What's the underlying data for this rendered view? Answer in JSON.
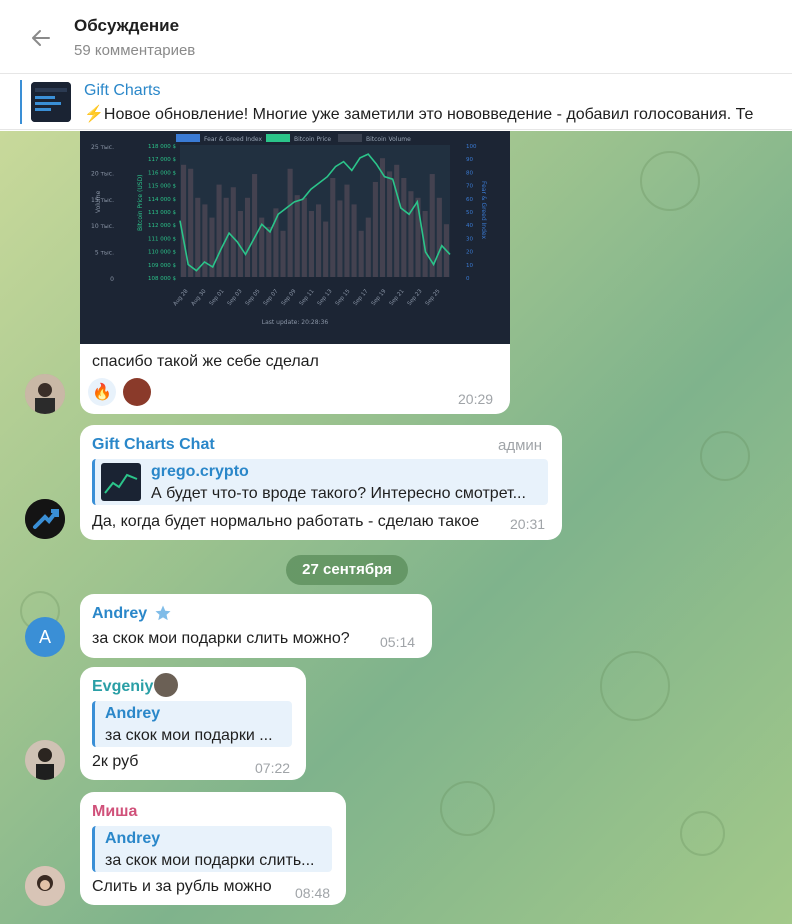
{
  "header": {
    "title": "Обсуждение",
    "subtitle": "59 комментариев"
  },
  "pinned": {
    "channel": "Gift Charts",
    "text": "⚡Новое обновление!  Многие уже заметили это нововведение - добавил голосования. Те"
  },
  "chart_preview": {
    "legend": [
      "Fear & Greed Index",
      "Bitcoin Price",
      "Bitcoin Volume"
    ],
    "y_left_labels": [
      "25 тыс.",
      "20 тыс.",
      "15 тыс.",
      "10 тыс.",
      "5 тыс.",
      "0"
    ],
    "y_price_labels": [
      "118 000 $",
      "117 000 $",
      "116 000 $",
      "115 000 $",
      "114 000 $",
      "113 000 $",
      "112 000 $",
      "111 000 $",
      "110 000 $",
      "109 000 $",
      "108 000 $"
    ],
    "y_right_labels": [
      "100",
      "90",
      "80",
      "70",
      "60",
      "50",
      "40",
      "30",
      "20",
      "10",
      "0"
    ],
    "x_labels": [
      "Aug 28",
      "Aug 30",
      "Sep 01",
      "Sep 03",
      "Sep 05",
      "Sep 07",
      "Sep 09",
      "Sep 11",
      "Sep 13",
      "Sep 15",
      "Sep 17",
      "Sep 19",
      "Sep 21",
      "Sep 23",
      "Sep 25"
    ],
    "left_axis_title": "Volume",
    "price_axis_title": "Bitcoin Price (USD)",
    "right_axis_title": "Fear & Greed Index",
    "footer": "Last update: 20:28:36",
    "colors": {
      "fear": "#3a7bd5",
      "price": "#2bc48a",
      "volume": "#3a4150"
    }
  },
  "messages": [
    {
      "text": "спасибо такой же себе сделал",
      "time": "20:29",
      "reactions": [
        "🔥",
        "avatar"
      ]
    },
    {
      "sender": "Gift Charts Chat",
      "badge": "админ",
      "quote_name": "grego.crypto",
      "quote_text": "А будет что-то вроде такого? Интересно смотрет...",
      "text": "Да, когда будет нормально работать - сделаю такое",
      "time": "20:31"
    },
    {
      "date": "27 сентября"
    },
    {
      "sender": "Andrey",
      "avatar_letter": "A",
      "text": "за скок мои подарки слить можно?",
      "time": "05:14"
    },
    {
      "sender": "Evgeniy",
      "quote_name": "Andrey",
      "quote_text": "за скок мои подарки ...",
      "text": "2к руб",
      "time": "07:22"
    },
    {
      "sender": "Миша",
      "quote_name": "Andrey",
      "quote_text": "за скок мои подарки слить...",
      "text": "Слить и за рубль можно",
      "time": "08:48"
    }
  ]
}
